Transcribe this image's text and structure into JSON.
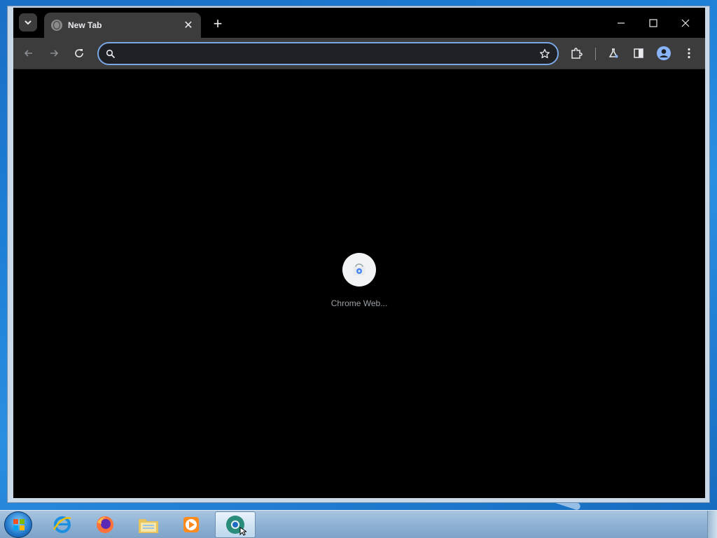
{
  "browser": {
    "tab": {
      "title": "New Tab",
      "close_glyph": "✕"
    },
    "new_tab_glyph": "+",
    "window_controls": {
      "minimize": "—",
      "maximize": "☐",
      "close": "✕"
    },
    "omnibox": {
      "value": "",
      "placeholder": ""
    },
    "accent_color": "#7aa7e6"
  },
  "content": {
    "shortcuts": [
      {
        "label": "Chrome Web..."
      }
    ]
  },
  "taskbar": {
    "apps": [
      "internet-explorer",
      "firefox",
      "file-explorer",
      "media-player",
      "chrome"
    ]
  }
}
